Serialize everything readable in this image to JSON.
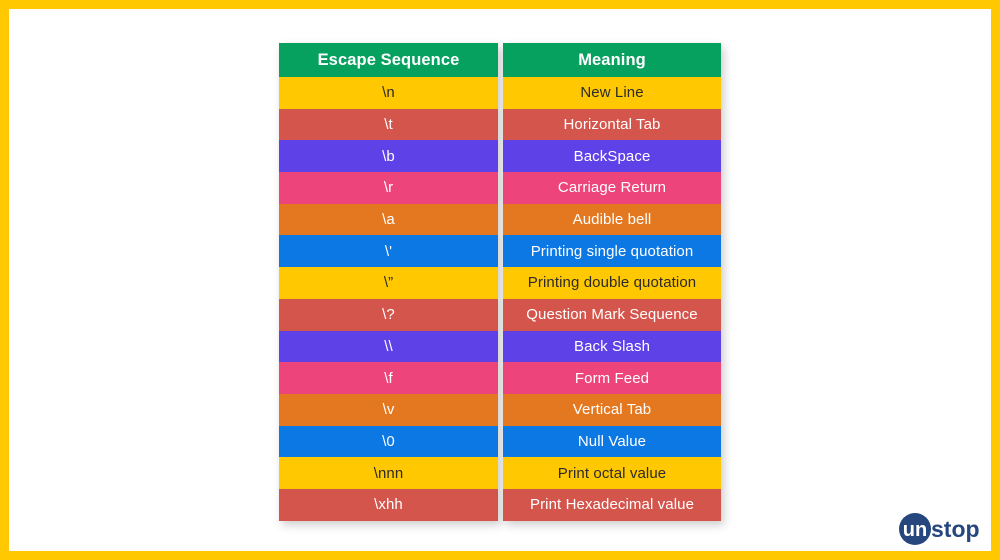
{
  "page": {
    "border_color": "#ffc800",
    "background": "#ffffff"
  },
  "table": {
    "headers": {
      "escape": "Escape Sequence",
      "meaning": "Meaning"
    },
    "header_color": "#06a15e",
    "palette": [
      "#ffc800",
      "#d4554c",
      "#5f41e8",
      "#ec447b",
      "#e47820",
      "#0c78e3"
    ],
    "rows": [
      {
        "escape": "\\n",
        "meaning": "New Line",
        "color": "#ffc800",
        "tone": "c-amber"
      },
      {
        "escape": "\\t",
        "meaning": "Horizontal Tab",
        "color": "#d4554c",
        "tone": "c-red"
      },
      {
        "escape": "\\b",
        "meaning": "BackSpace",
        "color": "#5f41e8",
        "tone": "c-purple"
      },
      {
        "escape": "\\r",
        "meaning": "Carriage Return",
        "color": "#ec447b",
        "tone": "c-pink"
      },
      {
        "escape": "\\a",
        "meaning": "Audible bell",
        "color": "#e47820",
        "tone": "c-orange"
      },
      {
        "escape": "\\'",
        "meaning": "Printing single quotation",
        "color": "#0c78e3",
        "tone": "c-blue"
      },
      {
        "escape": "\\”",
        "meaning": "Printing double quotation",
        "color": "#ffc800",
        "tone": "c-amber"
      },
      {
        "escape": "\\?",
        "meaning": "Question Mark Sequence",
        "color": "#d4554c",
        "tone": "c-red"
      },
      {
        "escape": "\\\\",
        "meaning": "Back Slash",
        "color": "#5f41e8",
        "tone": "c-purple"
      },
      {
        "escape": "\\f",
        "meaning": "Form Feed",
        "color": "#ec447b",
        "tone": "c-pink"
      },
      {
        "escape": "\\v",
        "meaning": "Vertical Tab",
        "color": "#e47820",
        "tone": "c-orange"
      },
      {
        "escape": "\\0",
        "meaning": "Null Value",
        "color": "#0c78e3",
        "tone": "c-blue"
      },
      {
        "escape": "\\nnn",
        "meaning": "Print octal value",
        "color": "#ffc800",
        "tone": "c-amber"
      },
      {
        "escape": "\\xhh",
        "meaning": "Print Hexadecimal value",
        "color": "#d4554c",
        "tone": "c-red"
      }
    ]
  },
  "logo": {
    "mark_text": "un",
    "word_text": "stop",
    "full_text": "unstop",
    "color": "#26477e",
    "mark_text_color": "#ffffff"
  }
}
